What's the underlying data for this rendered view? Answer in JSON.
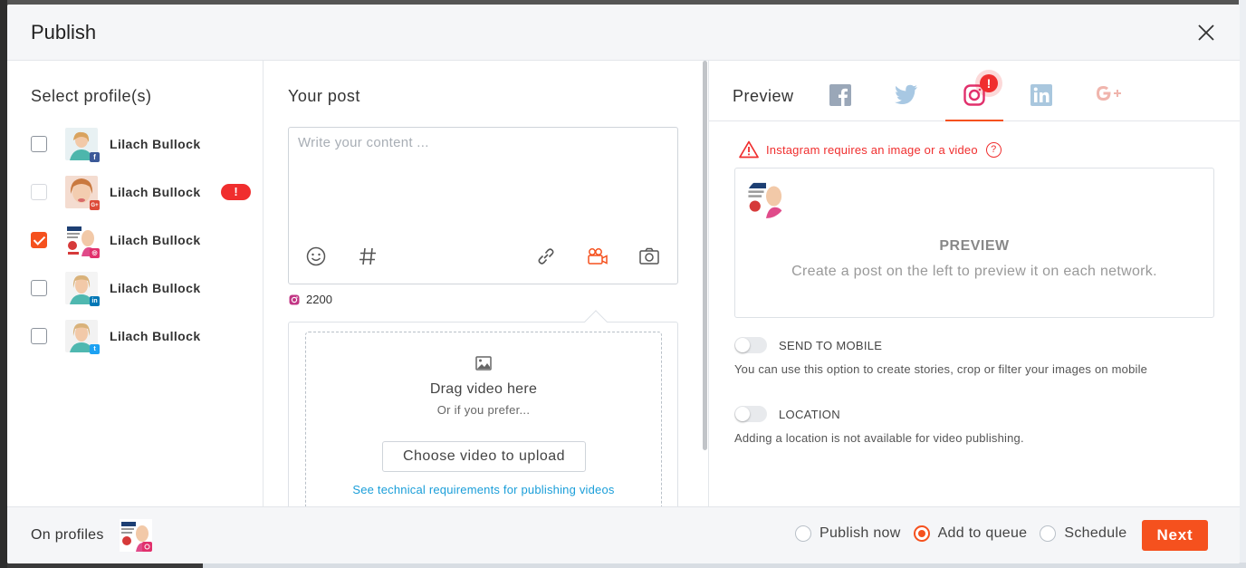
{
  "dialog": {
    "title": "Publish"
  },
  "profiles_panel": {
    "title": "Select profile(s)",
    "profiles": [
      {
        "name": "Lilach Bullock",
        "network": "facebook",
        "checked": false,
        "disabled": false,
        "warning": false
      },
      {
        "name": "Lilach Bullock",
        "network": "google-plus",
        "checked": false,
        "disabled": true,
        "warning": true,
        "warning_text": "!"
      },
      {
        "name": "Lilach Bullock",
        "network": "instagram",
        "checked": true,
        "disabled": false,
        "warning": false
      },
      {
        "name": "Lilach Bullock",
        "network": "linkedin",
        "checked": false,
        "disabled": false,
        "warning": false
      },
      {
        "name": "Lilach Bullock",
        "network": "twitter",
        "checked": false,
        "disabled": false,
        "warning": false
      }
    ]
  },
  "post_panel": {
    "title": "Your post",
    "placeholder": "Write your content ...",
    "tools": [
      "emoji-icon",
      "hashtag-icon",
      "link-icon",
      "video-camera-icon",
      "camera-icon"
    ],
    "char_counter": "2200",
    "upload": {
      "title": "Drag video here",
      "subtitle": "Or if you prefer...",
      "button_label": "Choose video to upload",
      "requirements_link": "See technical requirements for publishing videos"
    }
  },
  "preview_panel": {
    "title": "Preview",
    "tabs": [
      "facebook",
      "twitter",
      "instagram",
      "linkedin",
      "google-plus"
    ],
    "active_tab": "instagram",
    "tab_alert": "!",
    "warning": "Instagram requires an image or a video",
    "help_icon": "?",
    "card_title": "PREVIEW",
    "card_text": "Create a post on the left to preview it on each network.",
    "send_to_mobile": {
      "label": "SEND TO MOBILE",
      "description": "You can use this option to create stories, crop or filter your images on mobile",
      "enabled": false
    },
    "location": {
      "label": "LOCATION",
      "description": "Adding a location is not available for video publishing.",
      "enabled": false
    }
  },
  "footer": {
    "on_profiles_label": "On profiles",
    "options": [
      {
        "label": "Publish now",
        "selected": false
      },
      {
        "label": "Add to queue",
        "selected": true
      },
      {
        "label": "Schedule",
        "selected": false
      }
    ],
    "next_label": "Next"
  },
  "colors": {
    "accent": "#f5511e",
    "error": "#f02e2e",
    "link": "#1a9ed9",
    "facebook": "#3b5998",
    "twitter": "#1da1f2",
    "linkedin": "#0077b5",
    "google_plus": "#dd4b39",
    "instagram": "#e1306c"
  }
}
